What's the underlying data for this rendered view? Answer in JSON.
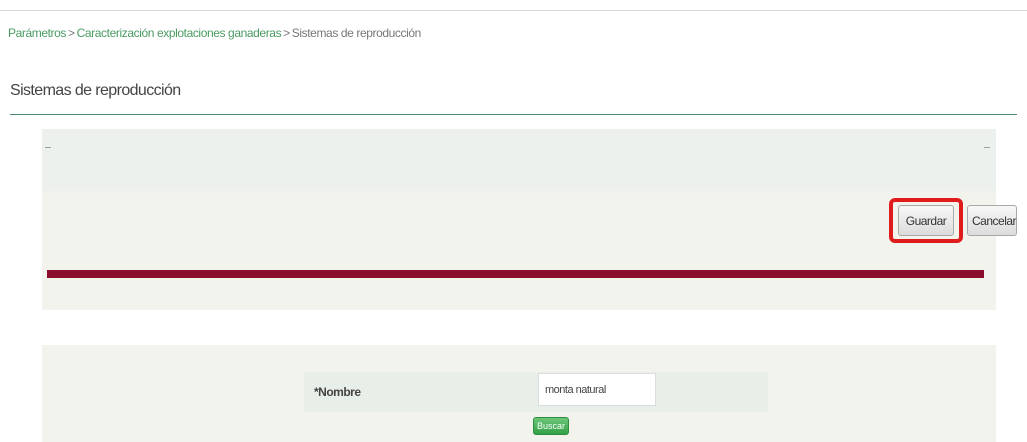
{
  "breadcrumb": {
    "items": [
      {
        "label": "Parámetros"
      },
      {
        "label": "Caracterización explotaciones ganaderas"
      },
      {
        "label": "Sistemas de reproducción"
      }
    ],
    "separator": ">"
  },
  "page": {
    "title": "Sistemas de reproducción"
  },
  "toolbar": {
    "save_label": "Guardar",
    "cancel_label": "Cancelar"
  },
  "form": {
    "name_label": "*Nombre",
    "name_value": "monta natural",
    "search_label": "Buscar"
  },
  "colors": {
    "accent_green": "#4a9a62",
    "divider_maroon": "#8b0d2d",
    "highlight_red": "#e01b1b",
    "search_button_green": "#33a046"
  }
}
